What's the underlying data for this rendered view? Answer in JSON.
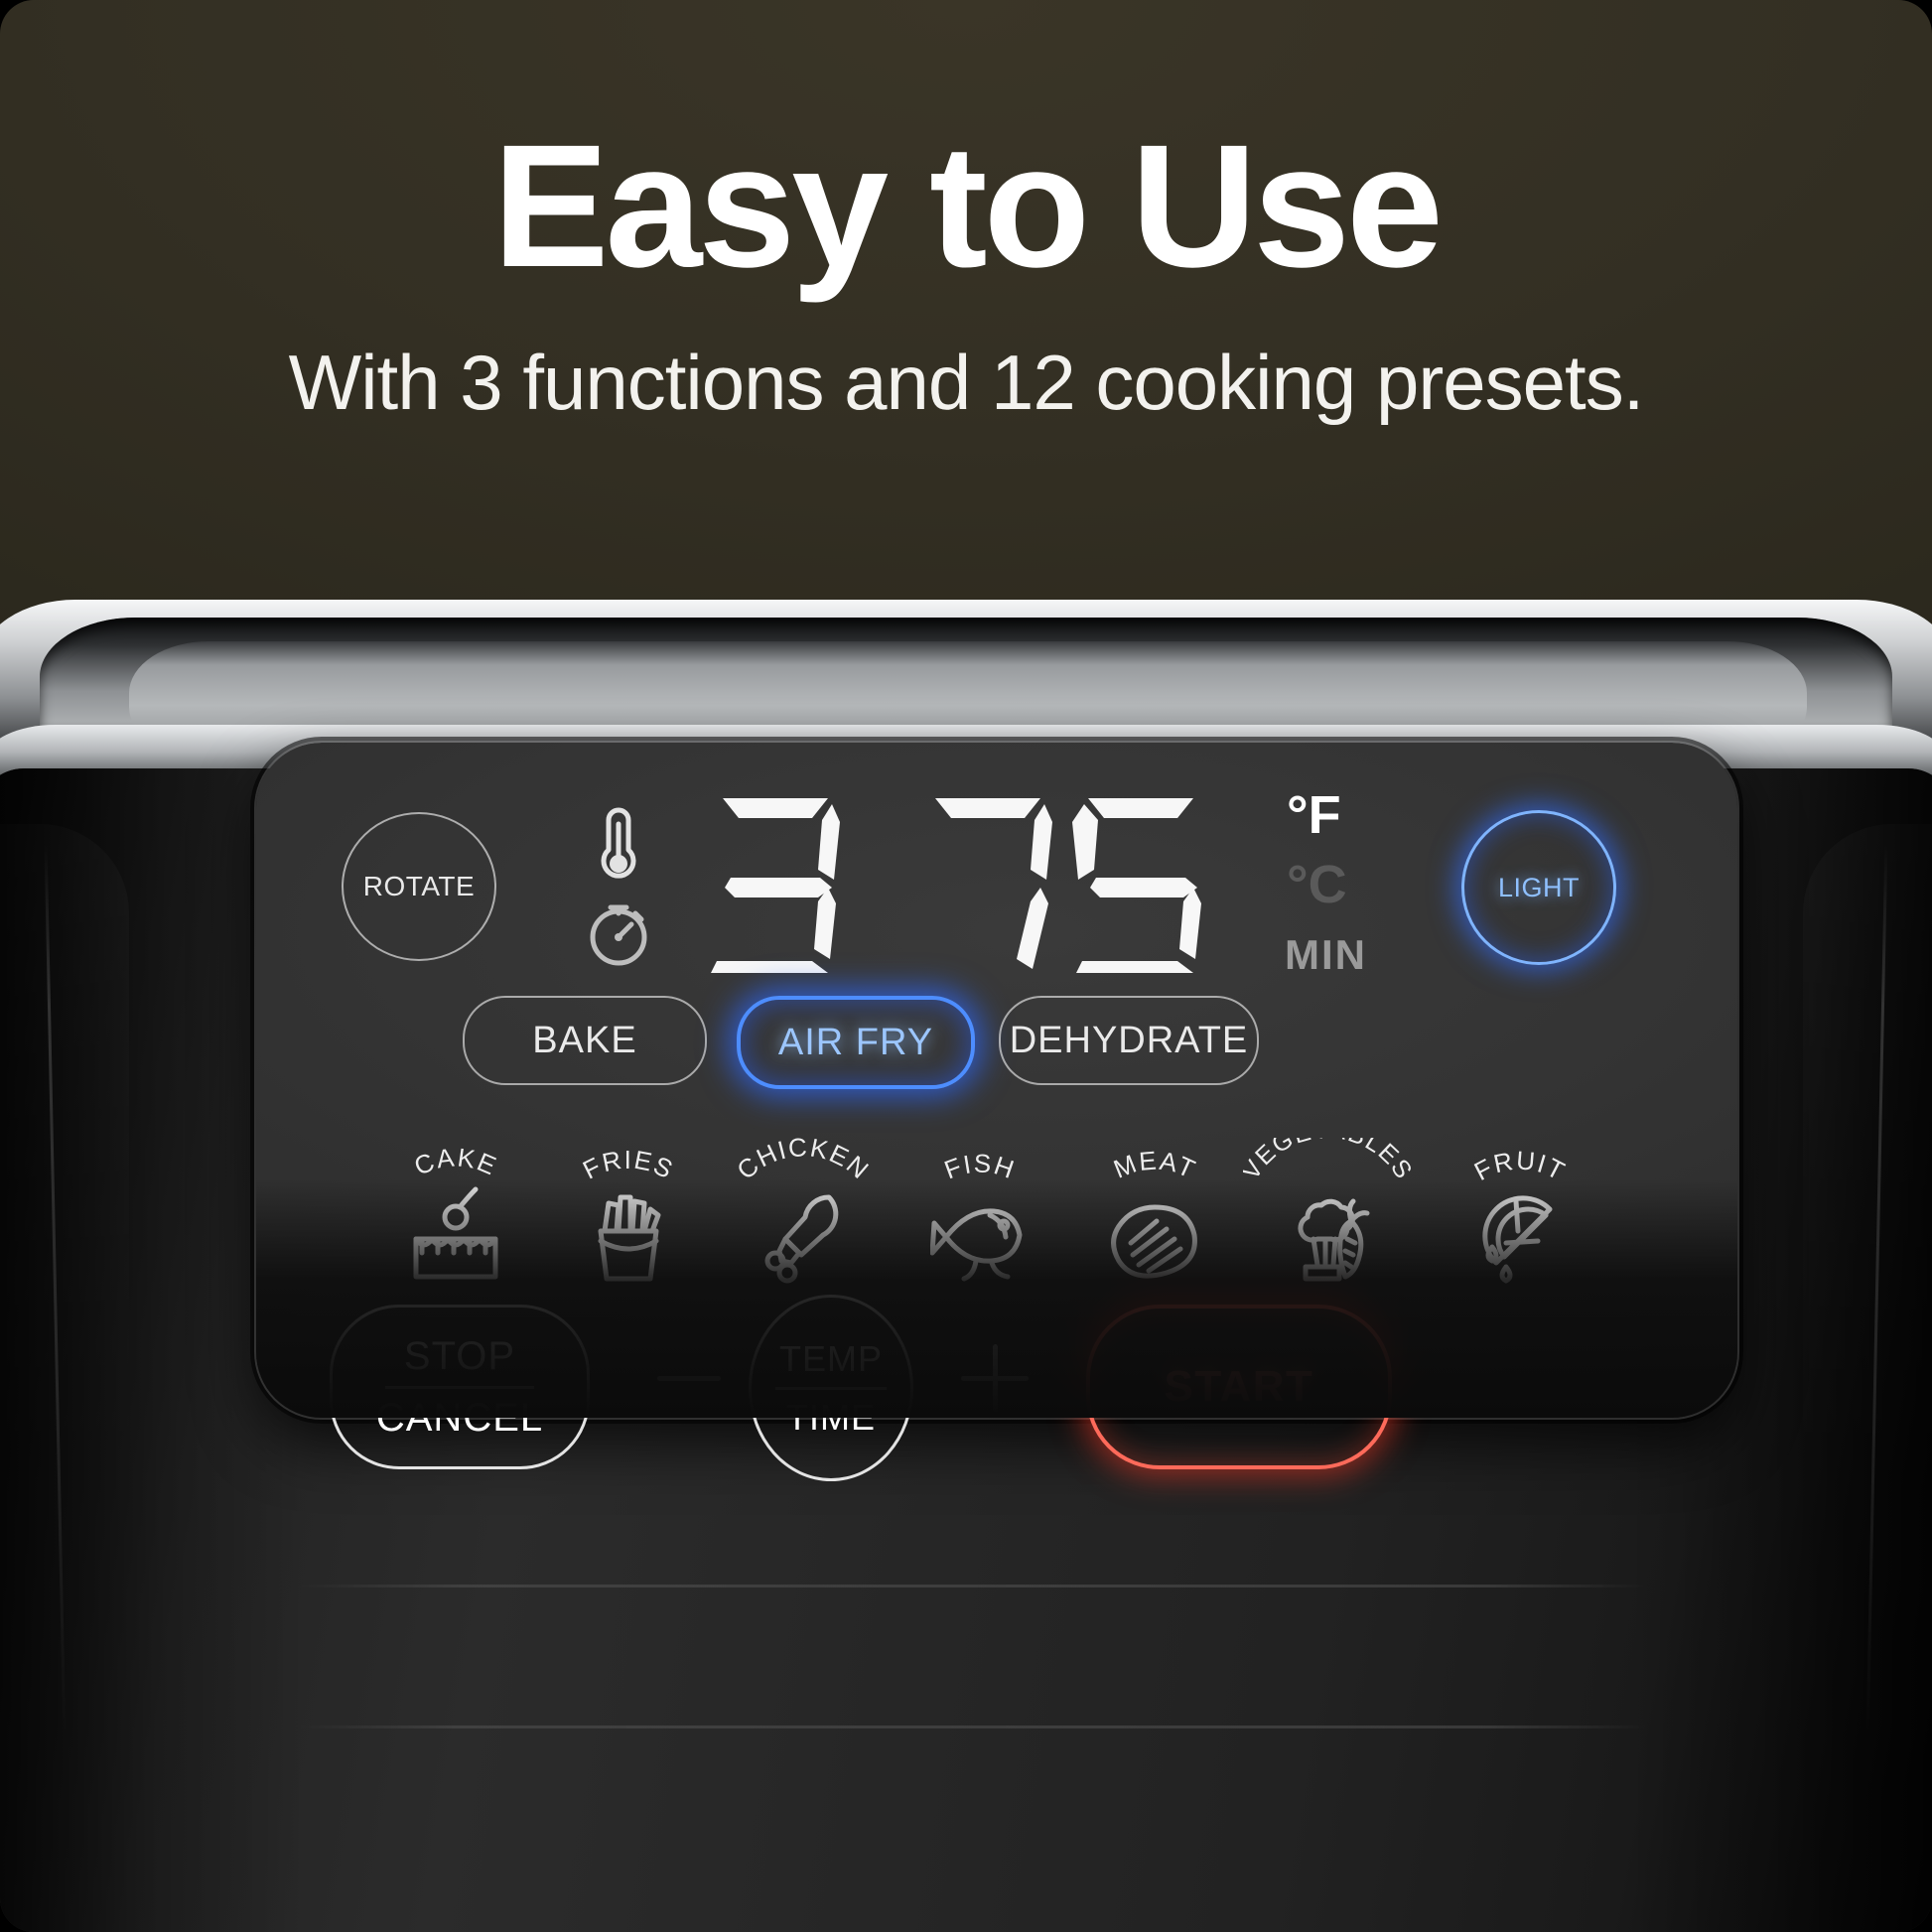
{
  "headline": {
    "title": "Easy to Use",
    "subtitle": "With 3 functions and 12 cooking presets."
  },
  "colors": {
    "background": "#332f23",
    "panel": "#2d2d2d",
    "accent_blue": "#4d8dff",
    "accent_red": "#ff6a5a",
    "text_white": "#ffffff",
    "text_dim": "#5a5a5a"
  },
  "control_panel": {
    "rotate_button": {
      "label": "ROTATE",
      "state": "off"
    },
    "indicators": {
      "thermometer_icon": "thermometer-icon",
      "timer_icon": "stopwatch-icon"
    },
    "display": {
      "value": "375",
      "digits": [
        "3",
        "7",
        "5"
      ]
    },
    "units": {
      "fahrenheit": "°F",
      "celsius": "°C",
      "minutes": "MIN",
      "active": "°F"
    },
    "light_button": {
      "label": "LIGHT",
      "state": "on"
    },
    "functions": [
      {
        "label": "BAKE",
        "state": "off"
      },
      {
        "label": "AIR FRY",
        "state": "on"
      },
      {
        "label": "DEHYDRATE",
        "state": "off"
      }
    ],
    "presets": [
      {
        "label": "CAKE",
        "icon": "cake-icon"
      },
      {
        "label": "FRIES",
        "icon": "fries-icon"
      },
      {
        "label": "CHICKEN",
        "icon": "chicken-drumstick-icon"
      },
      {
        "label": "FISH",
        "icon": "fish-icon"
      },
      {
        "label": "MEAT",
        "icon": "steak-icon"
      },
      {
        "label": "VEGETABLES",
        "icon": "vegetables-icon"
      },
      {
        "label": "FRUIT",
        "icon": "citrus-slice-icon"
      }
    ],
    "actions": {
      "stop_line1": "STOP",
      "stop_line2": "CANCEL",
      "minus": "–",
      "temp_line1": "TEMP",
      "temp_line2": "TIME",
      "plus": "+",
      "start": "START"
    }
  }
}
